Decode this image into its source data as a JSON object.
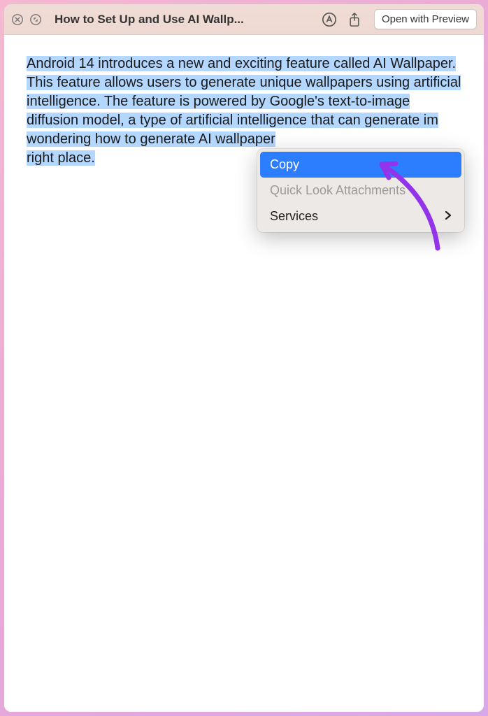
{
  "titlebar": {
    "title": "How to Set Up and Use AI Wallp...",
    "open_button": "Open with Preview"
  },
  "document": {
    "paragraph": "Android 14 introduces a new and exciting feature called AI Wallpaper. This feature allows users to generate unique wallpapers using artificial intelligence. The feature is powered by Google's text-to-image diffusion model, a type of artificial intelligence that can generate im",
    "paragraph_mid": "wondering how to generate AI wallpaper",
    "paragraph_end": "right place."
  },
  "context_menu": {
    "copy": "Copy",
    "quick_look": "Quick Look Attachments",
    "services": "Services"
  },
  "colors": {
    "highlight_bg": "#b4d7ff",
    "menu_selected": "#2d7dff",
    "annotation": "#9333ea"
  }
}
